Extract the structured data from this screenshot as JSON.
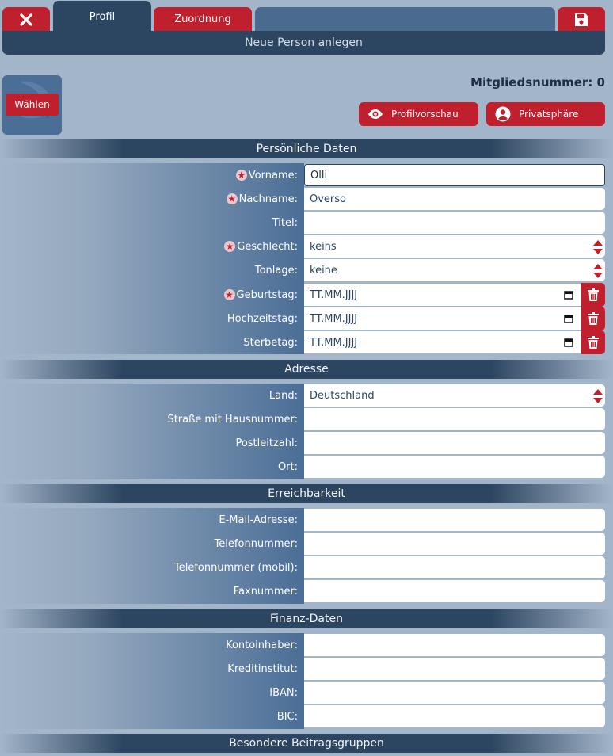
{
  "nav": {
    "tabs": [
      {
        "label": "Profil",
        "active": true
      },
      {
        "label": "Zuordnung",
        "active": false
      }
    ],
    "page_title": "Neue Person anlegen"
  },
  "profile": {
    "choose_label": "Wählen",
    "member_number": "Mitgliedsnummer: 0",
    "preview_label": "Profilvorschau",
    "privacy_label": "Privatsphäre"
  },
  "sections": {
    "personal": {
      "title": "Persönliche Daten",
      "fields": [
        {
          "label": "Vorname:",
          "value": "Olli",
          "required": true
        },
        {
          "label": "Nachname:",
          "value": "Overso",
          "required": true
        },
        {
          "label": "Titel:",
          "value": "",
          "required": false
        },
        {
          "label": "Geschlecht:",
          "value": "keins",
          "required": true
        },
        {
          "label": "Tonlage:",
          "value": "keine",
          "required": false
        },
        {
          "label": "Geburtstag:",
          "value": "TT.MM.JJJJ",
          "required": true
        },
        {
          "label": "Hochzeitstag:",
          "value": "TT.MM.JJJJ",
          "required": false
        },
        {
          "label": "Sterbetag:",
          "value": "TT.MM.JJJJ",
          "required": false
        }
      ]
    },
    "address": {
      "title": "Adresse",
      "fields": [
        {
          "label": "Land:",
          "value": "Deutschland"
        },
        {
          "label": "Straße mit Hausnummer:",
          "value": ""
        },
        {
          "label": "Postleitzahl:",
          "value": ""
        },
        {
          "label": "Ort:",
          "value": ""
        }
      ]
    },
    "contact": {
      "title": "Erreichbarkeit",
      "fields": [
        {
          "label": "E-Mail-Adresse:",
          "value": ""
        },
        {
          "label": "Telefonnummer:",
          "value": ""
        },
        {
          "label": "Telefonnummer (mobil):",
          "value": ""
        },
        {
          "label": "Faxnummer:",
          "value": ""
        }
      ]
    },
    "finance": {
      "title": "Finanz-Daten",
      "fields": [
        {
          "label": "Kontoinhaber:",
          "value": ""
        },
        {
          "label": "Kreditinstitut:",
          "value": ""
        },
        {
          "label": "IBAN:",
          "value": ""
        },
        {
          "label": "BIC:",
          "value": ""
        }
      ]
    },
    "special": {
      "title": "Besondere Beitragsgruppen"
    }
  },
  "colors": {
    "accent": "#c0202e",
    "dark": "#2c4560",
    "background": "#a3b5c9"
  }
}
